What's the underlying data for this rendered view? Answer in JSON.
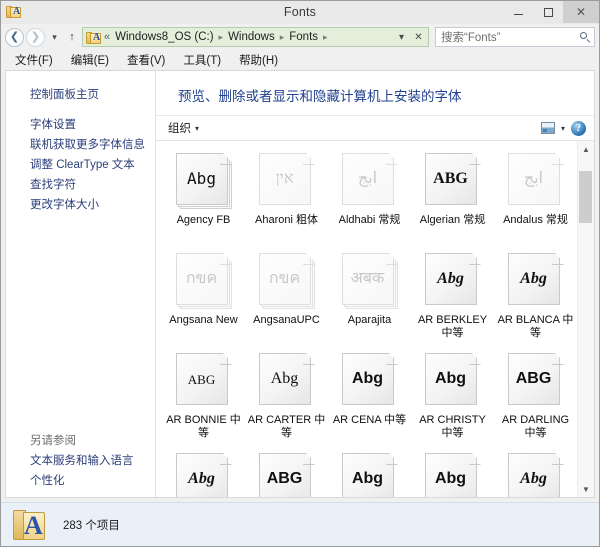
{
  "window": {
    "title": "Fonts",
    "icon": "fonts-folder-icon",
    "buttons": {
      "minimize": "minimize-button",
      "maximize": "maximize-button",
      "close": "close-button"
    }
  },
  "navbar": {
    "back": "back-button",
    "forward": "forward-button",
    "recent": "recent-locations-button",
    "up": "up-button",
    "breadcrumbs": [
      "Windows8_OS (C:)",
      "Windows",
      "Fonts"
    ],
    "overflow_chevron": "«",
    "separator": "▸",
    "dropdown": "address-dropdown-button",
    "refresh_stop": "stop-button",
    "search": {
      "placeholder": "搜索“Fonts”",
      "icon": "search-icon"
    }
  },
  "menubar": {
    "items": [
      "文件(F)",
      "编辑(E)",
      "查看(V)",
      "工具(T)",
      "帮助(H)"
    ]
  },
  "sidebar": {
    "home": "控制面板主页",
    "links": [
      "字体设置",
      "联机获取更多字体信息",
      "调整 ClearType 文本",
      "查找字符",
      "更改字体大小"
    ],
    "see_also_heading": "另请参阅",
    "see_also": [
      "文本服务和输入语言",
      "个性化"
    ]
  },
  "main": {
    "heading": "预览、删除或者显示和隐藏计算机上安装的字体",
    "toolbar": {
      "organize": "组织",
      "caret": "▾",
      "view_icon": "view-options-icon",
      "view_caret": "▾",
      "help_icon": "help-icon",
      "help_glyph": "?"
    }
  },
  "fonts": [
    {
      "name": "Agency FB",
      "sample": "Abg",
      "style": "s-mono",
      "dim": false,
      "stacked": true
    },
    {
      "name": "Aharoni 粗体",
      "sample": "אין",
      "style": "s-serif",
      "dim": true,
      "stacked": false
    },
    {
      "name": "Aldhabi 常规",
      "sample": "ابج",
      "style": "s-serif",
      "dim": true,
      "stacked": false
    },
    {
      "name": "Algerian 常规",
      "sample": "ABG",
      "style": "s-serif s-bold",
      "dim": false,
      "stacked": false
    },
    {
      "name": "Andalus 常规",
      "sample": "ابج",
      "style": "s-serif",
      "dim": true,
      "stacked": false
    },
    {
      "name": "Angsana New",
      "sample": "กขค",
      "style": "s-serif",
      "dim": true,
      "stacked": true
    },
    {
      "name": "AngsanaUPC",
      "sample": "กขค",
      "style": "s-serif",
      "dim": true,
      "stacked": true
    },
    {
      "name": "Aparajita",
      "sample": "अबक",
      "style": "s-serif",
      "dim": true,
      "stacked": true
    },
    {
      "name": "AR BERKLEY 中等",
      "sample": "Abg",
      "style": "s-ital",
      "dim": false,
      "stacked": false
    },
    {
      "name": "AR BLANCA 中等",
      "sample": "Abg",
      "style": "s-ital",
      "dim": false,
      "stacked": false
    },
    {
      "name": "AR BONNIE 中等",
      "sample": "ABG",
      "style": "s-serif s-small",
      "dim": false,
      "stacked": false
    },
    {
      "name": "AR CARTER 中等",
      "sample": "Abg",
      "style": "s-serif",
      "dim": false,
      "stacked": false
    },
    {
      "name": "AR CENA 中等",
      "sample": "Abg",
      "style": "s-bold",
      "dim": false,
      "stacked": false
    },
    {
      "name": "AR CHRISTY 中等",
      "sample": "Abg",
      "style": "s-bold",
      "dim": false,
      "stacked": false
    },
    {
      "name": "AR DARLING 中等",
      "sample": "ABG",
      "style": "s-bold",
      "dim": false,
      "stacked": false
    },
    {
      "name": "",
      "sample": "Abg",
      "style": "s-ital",
      "dim": false,
      "stacked": false
    },
    {
      "name": "",
      "sample": "ABG",
      "style": "s-bold",
      "dim": false,
      "stacked": false
    },
    {
      "name": "",
      "sample": "Abg",
      "style": "s-bold",
      "dim": false,
      "stacked": false
    },
    {
      "name": "",
      "sample": "Abg",
      "style": "s-bold",
      "dim": false,
      "stacked": false
    },
    {
      "name": "",
      "sample": "Abg",
      "style": "s-ital",
      "dim": false,
      "stacked": false
    }
  ],
  "scrollbar": {
    "up": "scroll-up-arrow",
    "down": "scroll-down-arrow",
    "up_glyph": "▲",
    "down_glyph": "▼"
  },
  "statusbar": {
    "icon": "fonts-folder-icon",
    "icon_letter": "A",
    "text": "283 个项目"
  }
}
